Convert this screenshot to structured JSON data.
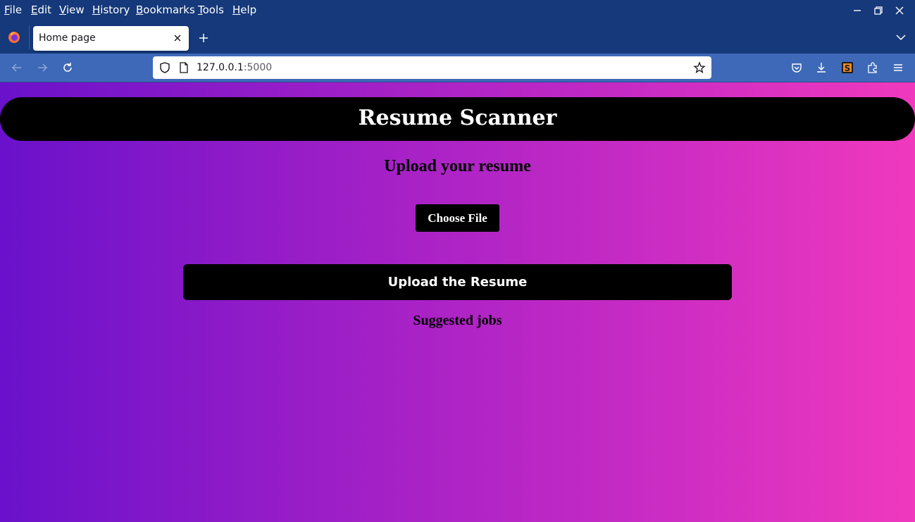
{
  "browser": {
    "menu": [
      {
        "label": "File",
        "underline": "F",
        "rest": "ile"
      },
      {
        "label": "Edit",
        "underline": "E",
        "rest": "dit"
      },
      {
        "label": "View",
        "underline": "V",
        "rest": "iew"
      },
      {
        "label": "History",
        "underline": "H",
        "rest": "istory"
      },
      {
        "label": "Bookmarks",
        "underline": "B",
        "rest": "ookmarks"
      },
      {
        "label": "Tools",
        "underline": "T",
        "rest": "ools"
      },
      {
        "label": "Help",
        "underline": "H",
        "rest": "elp"
      }
    ],
    "tab": {
      "title": "Home page"
    },
    "url": {
      "host": "127.0.0.1",
      "port": ":5000"
    }
  },
  "page": {
    "banner_title": "Resume Scanner",
    "subtitle": "Upload your resume",
    "choose_file_label": "Choose File",
    "upload_button_label": "Upload the Resume",
    "suggested_jobs_label": "Suggested jobs"
  },
  "colors": {
    "gradient_start": "#6a11cb",
    "gradient_end": "#f039bd",
    "browser_chrome": "#15397a",
    "nav_bar": "#3e69b8"
  }
}
